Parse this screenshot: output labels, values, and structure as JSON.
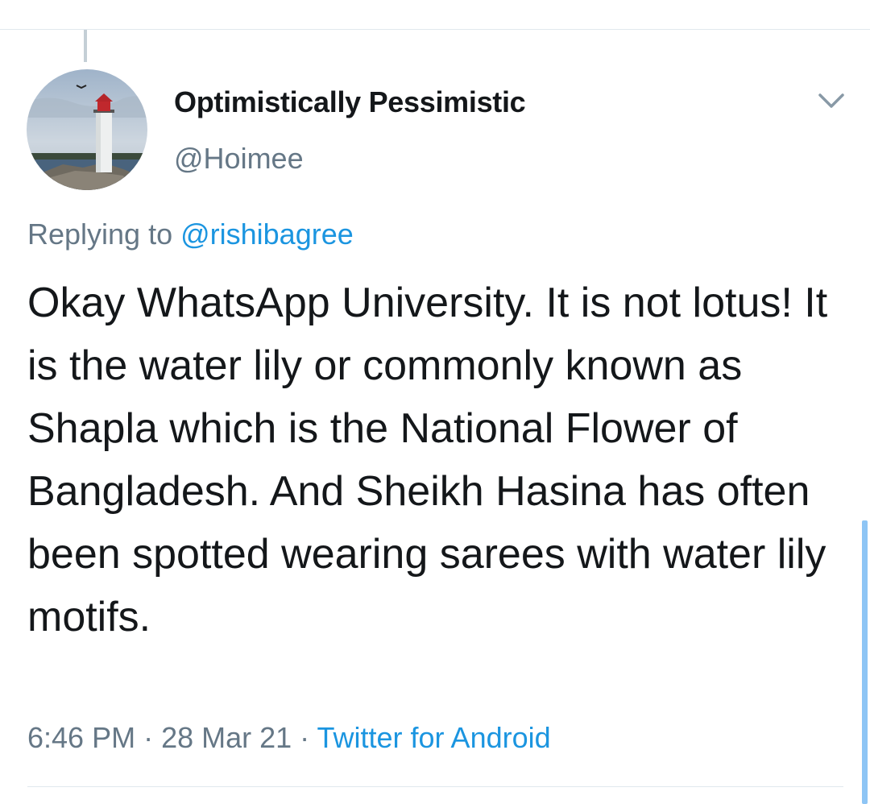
{
  "tweet": {
    "author": {
      "display_name": "Optimistically Pessimistic",
      "handle": "@Hoimee",
      "avatar_icon": "lighthouse-avatar"
    },
    "reply": {
      "prefix": "Replying to ",
      "target": "@rishibagree"
    },
    "text": "Okay WhatsApp University. It is not lotus! It is the water lily or commonly known as Shapla which is the National Flower of Bangladesh. And Sheikh Hasina has often been spotted wearing sarees with water lily motifs.",
    "meta": {
      "time": "6:46 PM",
      "separator": " · ",
      "date": "28 Mar 21",
      "source": "Twitter for Android"
    },
    "menu_icon": "chevron-down-icon"
  },
  "colors": {
    "text": "#14171a",
    "secondary": "#657786",
    "link": "#1b95e0",
    "divider": "#e1e8ed"
  }
}
